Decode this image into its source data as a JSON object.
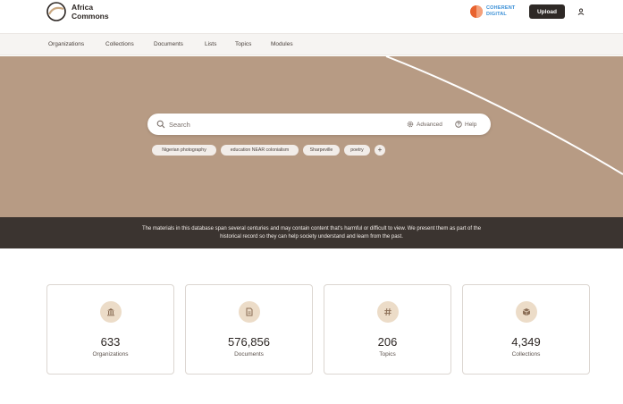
{
  "header": {
    "brand_line1": "Africa",
    "brand_line2": "Commons",
    "partner_line1": "COHERENT",
    "partner_line2": "DIGITAL",
    "upload_label": "Upload",
    "user_icon": "user-icon"
  },
  "nav": {
    "items": [
      {
        "label": "Organizations"
      },
      {
        "label": "Collections"
      },
      {
        "label": "Documents"
      },
      {
        "label": "Lists"
      },
      {
        "label": "Topics"
      },
      {
        "label": "Modules"
      }
    ]
  },
  "hero": {
    "background_color": "#b79b84",
    "search_placeholder": "Search",
    "advanced_label": "Advanced",
    "help_label": "Help",
    "chips": [
      {
        "label": "Nigerian photography"
      },
      {
        "label": "education NEAR colonialism"
      },
      {
        "label": "Sharpeville"
      },
      {
        "label": "poetry"
      }
    ],
    "add_chip_label": "+"
  },
  "disclaimer": {
    "line1": "The materials in this database span several centuries and may contain content that's harmful or difficult to view. We present them as part of the",
    "line2": "historical record so they can help society understand and learn from the past."
  },
  "stats": [
    {
      "value": "633",
      "label": "Organizations",
      "icon": "building-icon"
    },
    {
      "value": "576,856",
      "label": "Documents",
      "icon": "document-icon"
    },
    {
      "value": "206",
      "label": "Topics",
      "icon": "hashtag-icon"
    },
    {
      "value": "4,349",
      "label": "Collections",
      "icon": "box-icon"
    }
  ],
  "colors": {
    "accent_dark": "#2e2926",
    "hero": "#b79b84",
    "disclaimer_bg": "#3b3430",
    "icon_bg": "#ecdcc8"
  }
}
